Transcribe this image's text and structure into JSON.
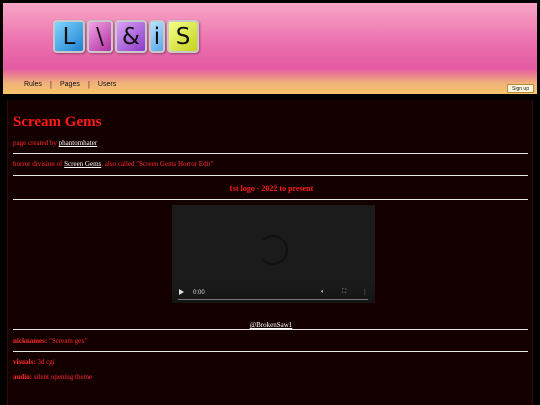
{
  "header": {
    "logo": {
      "tiles": [
        "L",
        "\\",
        "&",
        "i",
        "S"
      ]
    },
    "nav": [
      {
        "label": "Rules"
      },
      {
        "label": "Pages"
      },
      {
        "label": "Users"
      }
    ],
    "signup_label": "Sign up"
  },
  "page": {
    "title": "Scream Gems",
    "created_by_prefix": "page created by",
    "created_by_user": "phantomhater",
    "desc_prefix": "horror division of",
    "desc_link": "Screen Gems",
    "desc_suffix": ". also called \"Screen Gems Horror Edit\"",
    "section_title": "1st logo - 2022 to present",
    "video": {
      "time": "0:00"
    },
    "credit": "@BrokenSaw1",
    "nicknames_label": "nicknames:",
    "nicknames_value": "\"Scream gex\"",
    "visuals_label": "visuals:",
    "visuals_value": "3d cgi",
    "audio_label": "audio:",
    "audio_value": "silent opening theme"
  }
}
